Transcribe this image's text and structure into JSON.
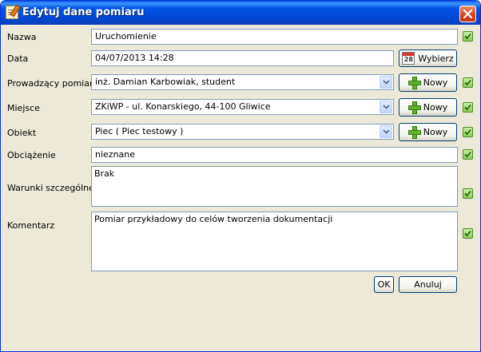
{
  "window": {
    "title": "Edytuj dane pomiaru"
  },
  "fields": {
    "nazwa": {
      "label": "Nazwa",
      "value": "Uruchomienie"
    },
    "data": {
      "label": "Data",
      "value": "04/07/2013 14:28",
      "button": "Wybierz",
      "calendar_day": "28"
    },
    "prowadzacy": {
      "label": "Prowadzący pomiary",
      "value": "inż. Damian Karbowiak, student",
      "button": "Nowy"
    },
    "miejsce": {
      "label": "Miejsce",
      "value": "ZKiWP - ul. Konarskiego, 44-100 Gliwice",
      "button": "Nowy"
    },
    "obiekt": {
      "label": "Obiekt",
      "value": "Piec ( Piec testowy )",
      "button": "Nowy"
    },
    "obciazenie": {
      "label": "Obciążenie",
      "value": "nieznane"
    },
    "warunki": {
      "label": "Warunki szczególne",
      "value": "Brak"
    },
    "komentarz": {
      "label": "Komentarz",
      "value": "Pomiar przykładowy do celów tworzenia dokumentacji"
    }
  },
  "buttons": {
    "ok": "OK",
    "cancel": "Anuluj"
  },
  "icons": [
    "edit-document-icon",
    "close-icon",
    "calendar-icon",
    "plus-icon",
    "dropdown-arrow-icon",
    "check-icon"
  ],
  "colors": {
    "title_bar": "#0055e5",
    "dialog_bg": "#ece9d8",
    "close_button": "#d2411c",
    "check_green": "#8dcc57"
  }
}
